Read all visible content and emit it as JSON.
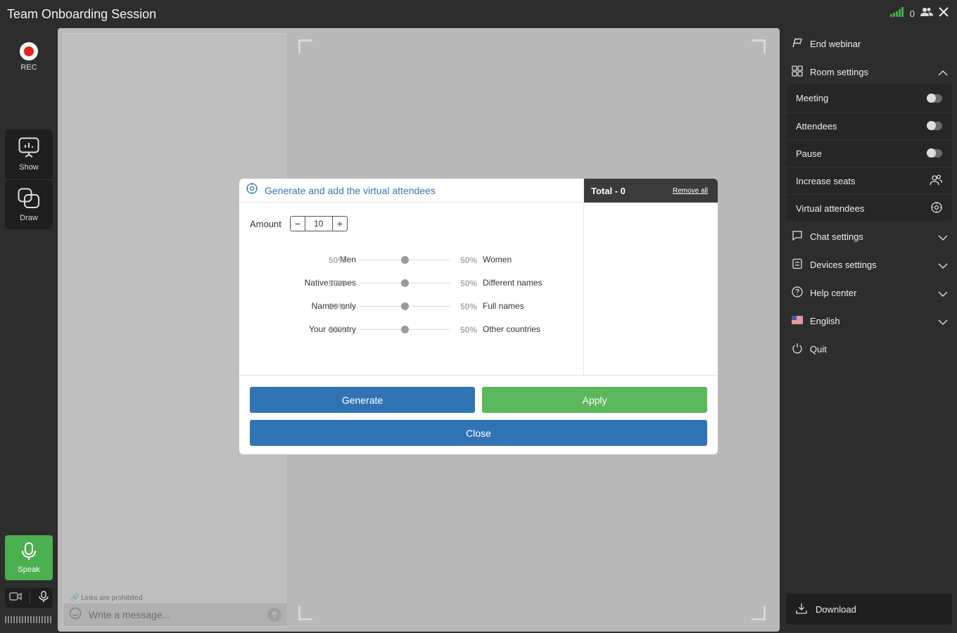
{
  "header": {
    "title": "Team Onboarding Session",
    "participants_count": "0"
  },
  "rail": {
    "rec_label": "REC",
    "show_label": "Show",
    "draw_label": "Draw",
    "speak_label": "Speak"
  },
  "chat": {
    "links_note": "Links are prohibited",
    "placeholder": "Write a message..."
  },
  "modal": {
    "title": "Generate and add the virtual attendees",
    "amount_label": "Amount",
    "amount_value": "10",
    "total_title": "Total - 0",
    "remove_all": "Remove all",
    "ratios": [
      {
        "left": "Men",
        "left_pct": "50%",
        "right_pct": "50%",
        "right": "Women",
        "value": 0.5
      },
      {
        "left": "Native names",
        "left_pct": "50%",
        "right_pct": "50%",
        "right": "Different names",
        "value": 0.5
      },
      {
        "left": "Names only",
        "left_pct": "50%",
        "right_pct": "50%",
        "right": "Full names",
        "value": 0.5
      },
      {
        "left": "Your country",
        "left_pct": "50%",
        "right_pct": "50%",
        "right": "Other countries",
        "value": 0.5
      }
    ],
    "generate_label": "Generate",
    "apply_label": "Apply",
    "close_label": "Close"
  },
  "sidebar": {
    "end_webinar": "End webinar",
    "room_settings": "Room settings",
    "room_items": {
      "meeting": "Meeting",
      "attendees": "Attendees",
      "pause": "Pause",
      "increase_seats": "Increase seats",
      "virtual_attendees": "Virtual attendees"
    },
    "chat_settings": "Chat settings",
    "devices_settings": "Devices settings",
    "help_center": "Help center",
    "language": "English",
    "quit": "Quit",
    "download": "Download"
  },
  "colors": {
    "primary_blue": "#3174b6",
    "apply_green": "#5cb85c",
    "speak_green": "#4caf50",
    "rec_red": "#e2231a",
    "signal_green": "#3cb043"
  }
}
